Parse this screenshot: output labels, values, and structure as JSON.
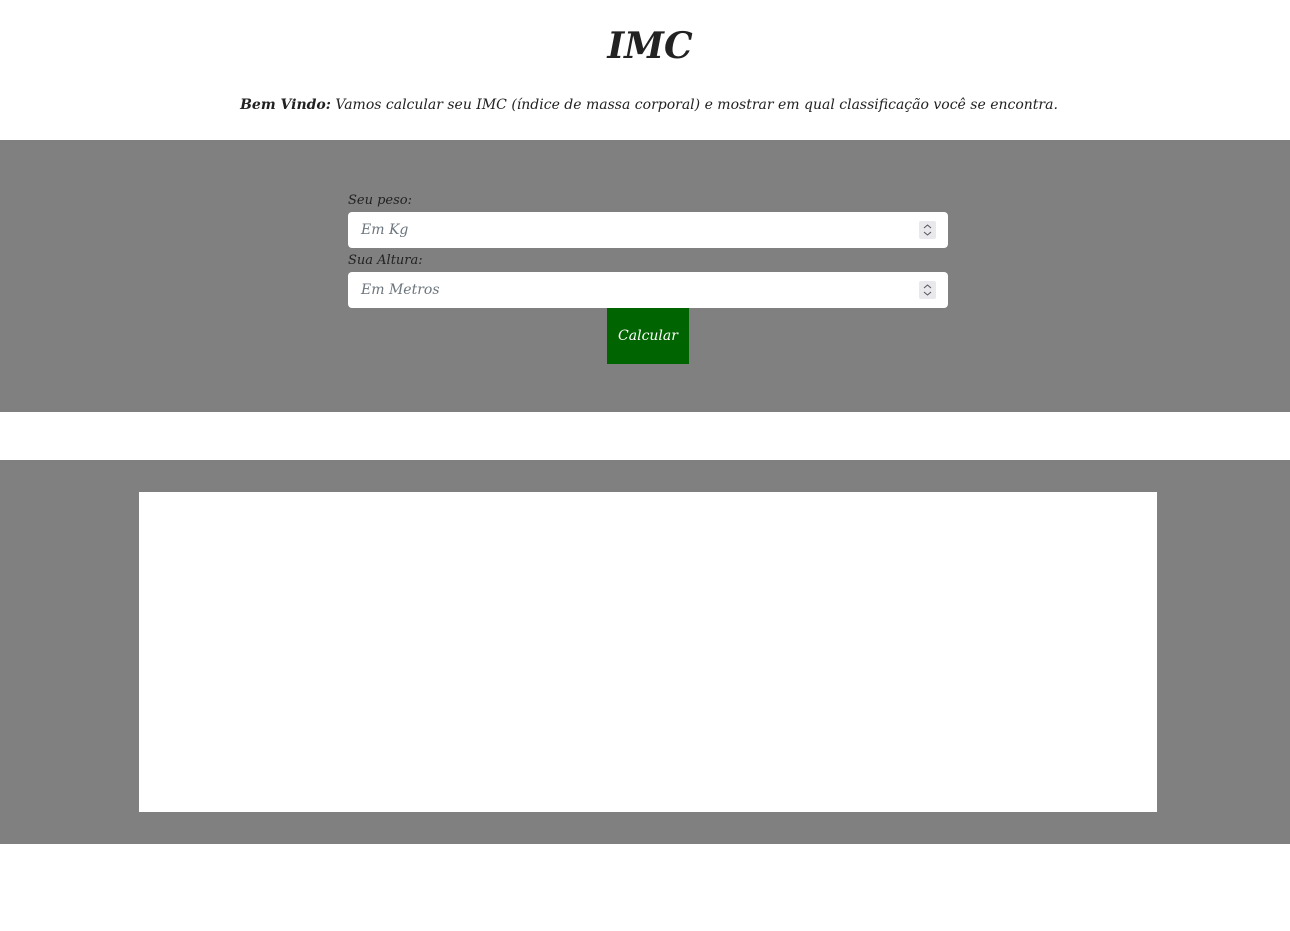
{
  "header": {
    "title": "IMC",
    "intro_bold": "Bem Vindo:",
    "intro_text": " Vamos calcular seu IMC (índice de massa corporal) e mostrar em qual classificação você se encontra."
  },
  "form": {
    "weight_label": "Seu peso:",
    "weight_placeholder": "Em Kg",
    "weight_value": "",
    "height_label": "Sua Altura:",
    "height_placeholder": "Em Metros",
    "height_value": "",
    "submit_label": "Calcular"
  },
  "icons": {
    "spinner": "up-down-stepper-icon"
  },
  "colors": {
    "band_background": "#808080",
    "button_background": "#006400",
    "button_text": "#ffffff"
  }
}
